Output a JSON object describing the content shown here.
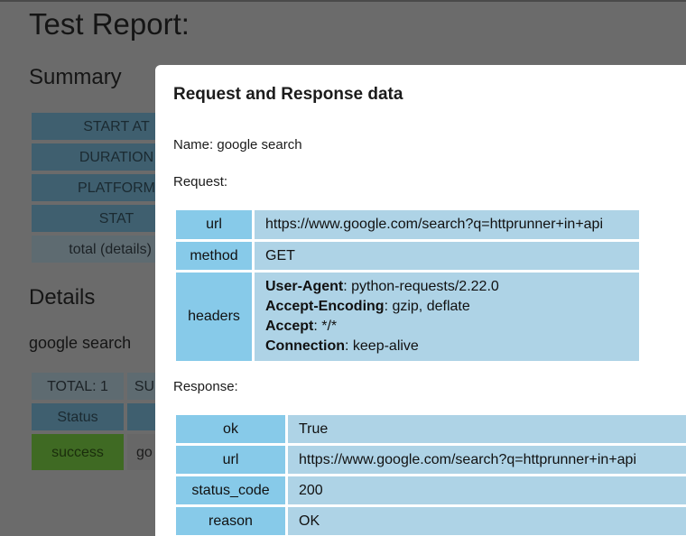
{
  "background": {
    "title": "Test Report:",
    "summary_heading": "Summary",
    "summary_rows": [
      "START AT",
      "DURATION",
      "PLATFORM",
      "STAT",
      "total (details) ="
    ],
    "details_heading": "Details",
    "testcase_name": "google search",
    "details_row1": [
      "TOTAL: 1",
      "SU"
    ],
    "details_status_label": "Status",
    "details_status_value": "success",
    "details_name_partial": "go"
  },
  "modal": {
    "title": "Request and Response data",
    "name_line": "Name: google search",
    "request_label": "Request:",
    "request": {
      "url_key": "url",
      "url_value": "https://www.google.com/search?q=httprunner+in+api",
      "method_key": "method",
      "method_value": "GET",
      "headers_key": "headers",
      "headers": [
        {
          "key": "User-Agent",
          "value": "python-requests/2.22.0"
        },
        {
          "key": "Accept-Encoding",
          "value": "gzip, deflate"
        },
        {
          "key": "Accept",
          "value": "*/*"
        },
        {
          "key": "Connection",
          "value": "keep-alive"
        }
      ]
    },
    "response_label": "Response:",
    "response": [
      {
        "key": "ok",
        "value": "True"
      },
      {
        "key": "url",
        "value": "https://www.google.com/search?q=httprunner+in+api"
      },
      {
        "key": "status_code",
        "value": "200"
      },
      {
        "key": "reason",
        "value": "OK"
      }
    ]
  }
}
